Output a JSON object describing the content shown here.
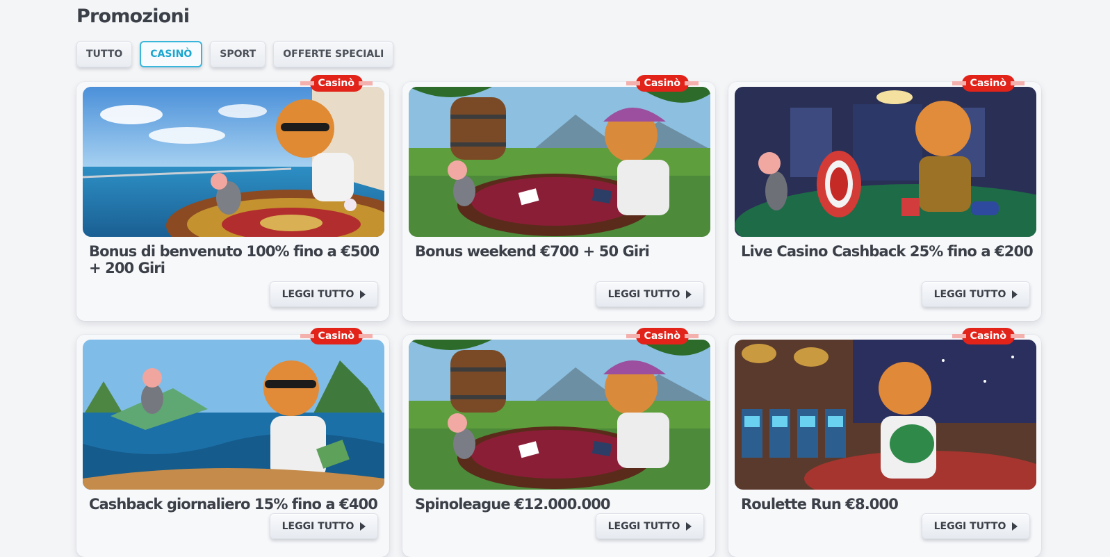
{
  "page": {
    "title": "Promozioni"
  },
  "filters": [
    {
      "label": "TUTTO",
      "active": false
    },
    {
      "label": "CASINÒ",
      "active": true
    },
    {
      "label": "SPORT",
      "active": false
    },
    {
      "label": "OFFERTE SPECIALI",
      "active": false
    }
  ],
  "promotions": [
    {
      "badge": "Casinò",
      "title": "Bonus di benvenuto 100% fino a €500 + 200 Giri",
      "button": "LEGGI TUTTO",
      "image": "yacht-roulette"
    },
    {
      "badge": "Casinò",
      "title": "Bonus weekend €700 + 50 Giri",
      "button": "LEGGI TUTTO",
      "image": "vineyard-blackjack"
    },
    {
      "badge": "Casinò",
      "title": "Live Casino Cashback 25% fino a €200",
      "button": "LEGGI TUTTO",
      "image": "live-casino-table"
    },
    {
      "badge": "Casinò",
      "title": "Cashback giornaliero 15% fino a €400",
      "button": "LEGGI TUTTO",
      "image": "ocean-cashback"
    },
    {
      "badge": "Casinò",
      "title": "Spinoleague €12.000.000",
      "button": "LEGGI TUTTO",
      "image": "vineyard-blackjack"
    },
    {
      "badge": "Casinò",
      "title": "Roulette Run €8.000",
      "button": "LEGGI TUTTO",
      "image": "slot-hall"
    }
  ],
  "colors": {
    "accent": "#39b6dc",
    "badge": "#e2231a",
    "text": "#3b3f47"
  }
}
